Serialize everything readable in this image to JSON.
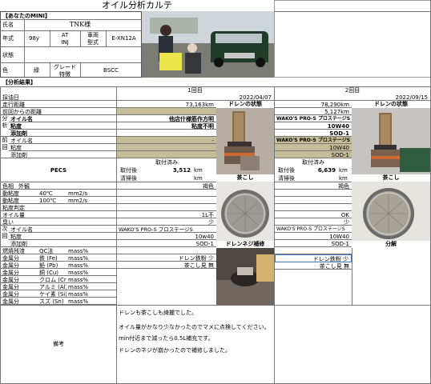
{
  "title": "オイル分析カルテ",
  "your_mini": "【あなたのMINI】",
  "name_label": "氏名",
  "name_value": "TNK様",
  "model_year_label": "年式",
  "model_year_value": "98y",
  "trans_top": "AT",
  "trans_bottom": "INJ",
  "vehicle_top": "車両",
  "vehicle_bottom": "型式",
  "vehicle_code": "E-XN12A",
  "status_label": "状態",
  "color_label": "色",
  "color_value": "緑",
  "grade_top": "グレード",
  "grade_bottom": "特徴",
  "grade_value": "BSCC",
  "analysis_results": "【分析結果】",
  "round1": "1回目",
  "round2": "2回目",
  "rows": {
    "sample_date": "採油日",
    "odometer": "走行距離",
    "prev_distance": "前回からの距離",
    "oil_name": "オイル名",
    "viscosity": "粘度",
    "additive": "添加剤",
    "prev_oil_name": "オイル名",
    "prev_viscosity": "粘度",
    "prev_additive": "添加剤",
    "pecs": "PECS",
    "color": "色相",
    "appearance": "外観",
    "kv40": "動粘度",
    "kv100": "動粘度",
    "visc_judge": "粘度判定",
    "oil_amount": "オイル量",
    "smell": "臭い",
    "next_oil_name": "オイル名",
    "next_viscosity": "粘度",
    "next_additive": "添加剤",
    "fuel_soot": "燃焼残渣",
    "metal": "金属分"
  },
  "side_labels": {
    "analysis": "分析",
    "prev": "前回",
    "next": "次回"
  },
  "temps": {
    "t40": "40℃",
    "t100": "100℃"
  },
  "units": {
    "cst": "mm2/s",
    "mass": "mass%",
    "km": "km"
  },
  "qc_method": "QC法",
  "metals": [
    "鉄 (Fe)",
    "鉛 (Pb)",
    "銅 (Cu)",
    "クロム (Cr)",
    "アルミ (Al)",
    "ケイ素 (Si)",
    "スズ (Sn)"
  ],
  "r1": {
    "date": "2022/04/07",
    "odometer": "73,163km",
    "oil_name": "他店什様筋作方明",
    "viscosity": "粘度不明",
    "prev_oil_name": "-",
    "pecs_taken": "取付済み",
    "pecs_mount_label": "取付後",
    "pecs_mount_value": "3,512",
    "pecs_clean_label": "清掃後",
    "color_value": "褐色",
    "oil_amount": "1L不",
    "smell": "少",
    "next_oil_name": "WAKO'S PRO-S プロステージS",
    "next_viscosity": "10w40",
    "next_additive": "SOD-1",
    "drain_iron": "ドレン鉄粉 少",
    "strainer": "茶こし見 無"
  },
  "r2": {
    "date": "2022/09/15",
    "odometer": "78,290km",
    "distance": "5,127km",
    "oil_name": "WAKO'S PRO-S プロステージS",
    "viscosity": "10W40",
    "additive": "SOD-1",
    "prev_oil_name": "WAKO'S PRO-S プロステージS",
    "prev_viscosity": "10W40",
    "prev_additive": "SOD-1",
    "pecs_taken": "取付済み",
    "pecs_mount_label": "取付後",
    "pecs_mount_value": "6,639",
    "pecs_clean_label": "清掃後",
    "color_value": "褐色",
    "oil_amount": "OK",
    "smell": "少",
    "next_oil_name": "WAKO'S PRO-S プロステージS",
    "next_viscosity": "10W40",
    "next_additive": "SOD-1",
    "drain_iron": "ドレン鉄粉 少",
    "strainer": "茶こし見 無"
  },
  "photo_labels": {
    "drain_state_1": "ドレンの状態",
    "strainer_1": "茶こし",
    "drain_screw_1": "ドレンネジ補修",
    "drain_state_2": "ドレンの状態",
    "strainer_2": "茶こし",
    "breakdown_2": "分解"
  },
  "remarks_label": "備考",
  "remarks": [
    "ドレンも茶こしも綺麗でした。",
    "オイル量がかなり少なかったのでマメに点検してください。",
    "min付近まで減ったら0.5L補充です。",
    "ドレンのネジが崩かったので補修しました。"
  ]
}
